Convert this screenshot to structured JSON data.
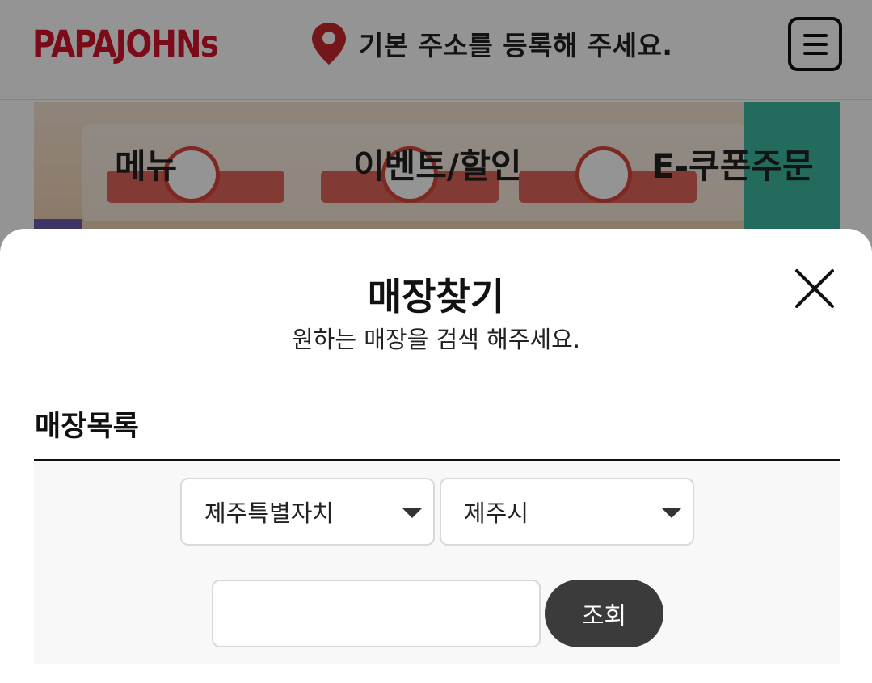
{
  "header": {
    "logo_text": "PAPAJOHNs",
    "address_prompt": "기본 주소를 등록해 주세요.",
    "menu_icon": "hamburger-menu-icon",
    "brand_color": "#d4132b"
  },
  "nav": {
    "items": [
      {
        "label": "메뉴"
      },
      {
        "label": "이벤트/할인"
      },
      {
        "label": "E-쿠폰주문"
      }
    ]
  },
  "modal": {
    "title": "매장찾기",
    "subtitle": "원하는 매장을 검색 해주세요.",
    "close_icon": "close-icon",
    "section_label": "매장목록",
    "region_select": {
      "value": "제주특별자치"
    },
    "city_select": {
      "value": "제주시"
    },
    "search_input": {
      "value": "",
      "placeholder": ""
    },
    "search_button_label": "조회",
    "button_color": "#3b3b3b"
  }
}
